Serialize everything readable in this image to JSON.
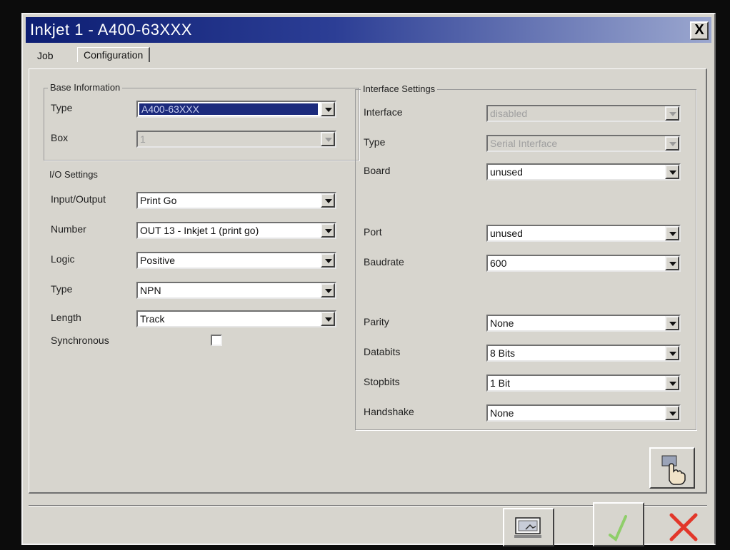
{
  "window": {
    "title": "Inkjet 1   -   A400-63XXX",
    "close_label": "X"
  },
  "tabs": [
    {
      "label": "Job",
      "active": false
    },
    {
      "label": "Configuration",
      "active": true
    }
  ],
  "base_information": {
    "title": "Base Information",
    "type_label": "Type",
    "type_value": "A400-63XXX",
    "box_label": "Box",
    "box_value": "1"
  },
  "io_settings": {
    "title": "I/O Settings",
    "input_output_label": "Input/Output",
    "input_output_value": "Print Go",
    "number_label": "Number",
    "number_value": "OUT 13 - Inkjet 1 (print go)",
    "logic_label": "Logic",
    "logic_value": "Positive",
    "type_label": "Type",
    "type_value": "NPN",
    "length_label": "Length",
    "length_value": "Track",
    "synchronous_label": "Synchronous"
  },
  "interface_settings": {
    "title": "Interface Settings",
    "interface_label": "Interface",
    "interface_value": "disabled",
    "type_label": "Type",
    "type_value": "Serial Interface",
    "board_label": "Board",
    "board_value": "unused",
    "port_label": "Port",
    "port_value": "unused",
    "baudrate_label": "Baudrate",
    "baudrate_value": "600",
    "parity_label": "Parity",
    "parity_value": "None",
    "databits_label": "Databits",
    "databits_value": "8 Bits",
    "stopbits_label": "Stopbits",
    "stopbits_value": "1 Bit",
    "handshake_label": "Handshake",
    "handshake_value": "None"
  },
  "icons": {
    "hand_button": "hand-pointer-icon",
    "screen_button": "monitor-icon",
    "ok_button": "checkmark-icon",
    "cancel_button": "red-x-icon"
  },
  "colors": {
    "ok_green": "#8fce6a",
    "cancel_red": "#e2372a",
    "title_blue": "#0d1e73"
  }
}
